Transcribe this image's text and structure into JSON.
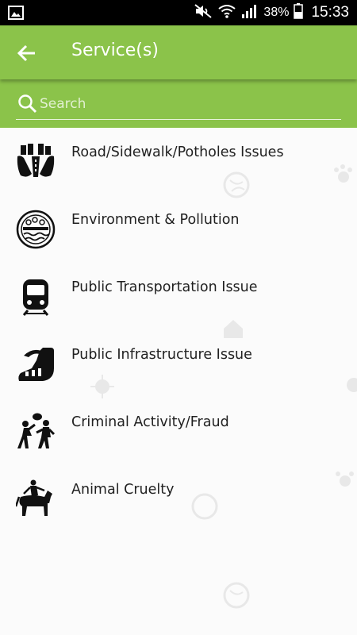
{
  "status_bar": {
    "battery": "38%",
    "time": "15:33",
    "icons": [
      "gallery-icon",
      "mute-icon",
      "wifi-icon",
      "signal-icon",
      "battery-icon"
    ]
  },
  "app_bar": {
    "title": "Service(s)",
    "back_icon": "arrow-left-icon",
    "color": "#8bc34a"
  },
  "search": {
    "placeholder": "Search",
    "value": "",
    "icon": "search-icon"
  },
  "services": [
    {
      "label": "Road/Sidewalk/Potholes Issues",
      "icon": "road-icon"
    },
    {
      "label": "Environment & Pollution",
      "icon": "environment-icon"
    },
    {
      "label": "Public Transportation Issue",
      "icon": "train-icon"
    },
    {
      "label": "Public Infrastructure Issue",
      "icon": "infrastructure-icon"
    },
    {
      "label": "Criminal Activity/Fraud",
      "icon": "crime-icon"
    },
    {
      "label": "Animal Cruelty",
      "icon": "animal-icon"
    }
  ]
}
